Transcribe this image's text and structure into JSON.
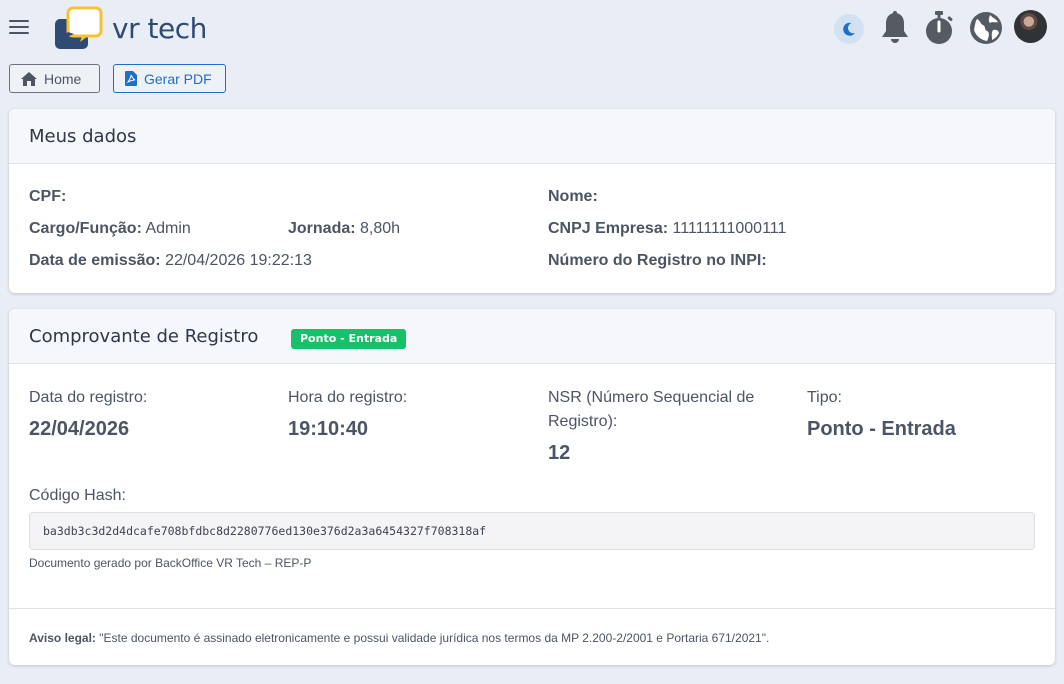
{
  "topbar": {
    "logo_text": "vr tech",
    "icons": [
      "menu-icon",
      "moon-icon",
      "bell-icon",
      "stopwatch-icon",
      "globe-icon",
      "avatar"
    ]
  },
  "actions": {
    "home_label": "Home",
    "pdf_label": "Gerar PDF"
  },
  "meus_dados": {
    "title": "Meus dados",
    "cpf_label": "CPF:",
    "cpf_value": "",
    "nome_label": "Nome:",
    "nome_value": "",
    "cargo_label": "Cargo/Função:",
    "cargo_value": "Admin",
    "jornada_label": "Jornada:",
    "jornada_value": "8,80h",
    "cnpj_label": "CNPJ Empresa:",
    "cnpj_value": "11111111000111",
    "emissao_label": "Data de emissão:",
    "emissao_value": "22/04/2026 19:22:13",
    "inpi_label": "Número do Registro no INPI:",
    "inpi_value": ""
  },
  "comprovante": {
    "title": "Comprovante de Registro",
    "badge": "Ponto - Entrada",
    "data_label": "Data do registro:",
    "data_value": "22/04/2026",
    "hora_label": "Hora do registro:",
    "hora_value": "19:10:40",
    "nsr_label_1": "NSR (Número Sequencial de",
    "nsr_label_2": "Registro):",
    "nsr_value": "12",
    "tipo_label": "Tipo:",
    "tipo_value": "Ponto - Entrada",
    "hash_label": "Código Hash:",
    "hash_value": "ba3db3c3d2d4dcafe708bfdbc8d2280776ed130e376d2a3a6454327f708318af",
    "footer_note": "Documento gerado por BackOffice VR Tech – REP-P",
    "aviso_label": "Aviso legal:",
    "aviso_text": "\"Este documento é assinado eletronicamente e possui validade jurídica nos termos da MP 2.200-2/2001 e Portaria 671/2021\"."
  },
  "colors": {
    "background": "#e9edf5",
    "primary": "#1f6fc4",
    "badge_green": "#18c06a",
    "logo_yellow": "#f4c430",
    "logo_navy": "#2f4a73"
  }
}
